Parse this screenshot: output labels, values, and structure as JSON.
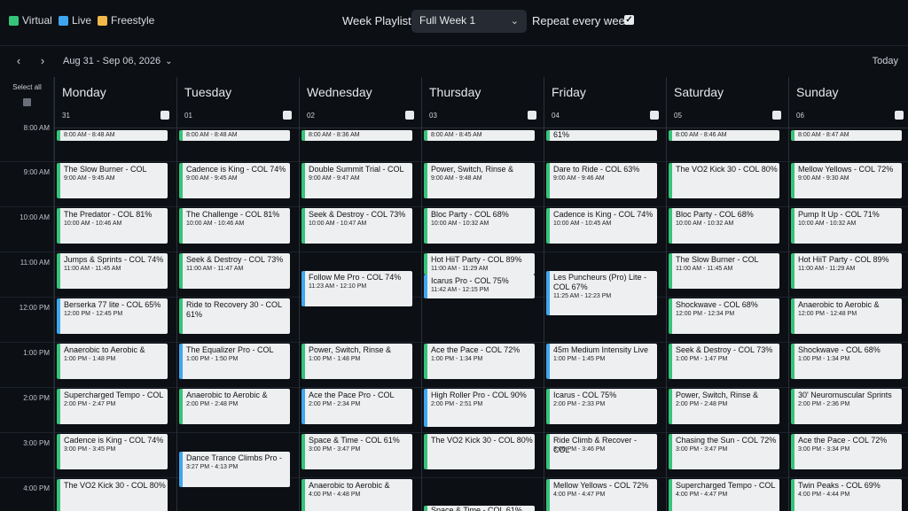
{
  "legend": [
    {
      "label": "Virtual",
      "color": "#36c47a"
    },
    {
      "label": "Live",
      "color": "#3fa7ee"
    },
    {
      "label": "Freestyle",
      "color": "#f2b94a"
    }
  ],
  "toolbar": {
    "week_playlist_label": "Week Playlist:",
    "week_playlist_value": "Full Week 1",
    "repeat_label": "Repeat every week",
    "repeat_checked": true
  },
  "nav": {
    "prev": "‹",
    "next": "›",
    "range": "Aug 31 - Sep 06, 2026",
    "today": "Today"
  },
  "grid": {
    "select_all": "Select all",
    "time_labels": [
      "8:00 AM",
      "9:00 AM",
      "10:00 AM",
      "11:00 AM",
      "12:00 PM",
      "1:00 PM",
      "2:00 PM",
      "3:00 PM",
      "4:00 PM"
    ],
    "days": [
      {
        "name": "Monday",
        "num": "31",
        "events": [
          {
            "title": "",
            "time": "8:00 AM - 8:48 AM",
            "type": "virtual",
            "slot": "8",
            "p": "cut"
          },
          {
            "title": "The Slow Burner - COL",
            "time": "9:00 AM - 9:45 AM",
            "type": "virtual",
            "slot": "9",
            "p": "n"
          },
          {
            "title": "The Predator - COL 81%",
            "time": "10:00 AM - 10:46 AM",
            "type": "virtual",
            "slot": "10",
            "p": "n"
          },
          {
            "title": "Jumps & Sprints - COL 74%",
            "time": "11:00 AM - 11:45 AM",
            "type": "virtual",
            "slot": "11",
            "p": "n"
          },
          {
            "title": "Berserka 77 lite - COL 65%",
            "time": "12:00 PM - 12:45 PM",
            "type": "live",
            "slot": "12",
            "p": "n"
          },
          {
            "title": "Anaerobic to Aerobic &",
            "time": "1:00 PM - 1:48 PM",
            "type": "virtual",
            "slot": "13",
            "p": "n"
          },
          {
            "title": "Supercharged Tempo - COL",
            "time": "2:00 PM - 2:47 PM",
            "type": "virtual",
            "slot": "14",
            "p": "n"
          },
          {
            "title": "Cadence is King - COL 74%",
            "time": "3:00 PM - 3:45 PM",
            "type": "virtual",
            "slot": "15",
            "p": "n"
          },
          {
            "title": "The VO2 Kick 30 - COL 80%",
            "time": "",
            "type": "virtual",
            "slot": "16",
            "p": "n"
          }
        ]
      },
      {
        "name": "Tuesday",
        "num": "01",
        "events": [
          {
            "title": "",
            "time": "8:00 AM - 8:48 AM",
            "type": "virtual",
            "slot": "8",
            "p": "cut"
          },
          {
            "title": "Cadence is King - COL 74%",
            "time": "9:00 AM - 9:45 AM",
            "type": "virtual",
            "slot": "9",
            "p": "n"
          },
          {
            "title": "The Challenge - COL 81%",
            "time": "10:00 AM - 10:46 AM",
            "type": "virtual",
            "slot": "10",
            "p": "n"
          },
          {
            "title": "Seek & Destroy - COL 73%",
            "time": "11:00 AM - 11:47 AM",
            "type": "virtual",
            "slot": "11",
            "p": "n"
          },
          {
            "title": "Ride to Recovery 30 - COL 61%",
            "time": "",
            "type": "virtual",
            "slot": "12",
            "p": "n"
          },
          {
            "title": "The Equalizer Pro - COL",
            "time": "1:00 PM - 1:50 PM",
            "type": "live",
            "slot": "13",
            "p": "n"
          },
          {
            "title": "Anaerobic to Aerobic &",
            "time": "2:00 PM - 2:48 PM",
            "type": "virtual",
            "slot": "14",
            "p": "n"
          },
          {
            "title": "Dance Trance Climbs Pro -",
            "time": "3:27 PM - 4:13 PM",
            "type": "live",
            "slot": "15",
            "p": "off"
          }
        ]
      },
      {
        "name": "Wednesday",
        "num": "02",
        "events": [
          {
            "title": "",
            "time": "8:00 AM - 8:36 AM",
            "type": "virtual",
            "slot": "8",
            "p": "cut"
          },
          {
            "title": "Double Summit Trial - COL",
            "time": "9:00 AM - 9:47 AM",
            "type": "virtual",
            "slot": "9",
            "p": "n"
          },
          {
            "title": "Seek & Destroy - COL 73%",
            "time": "10:00 AM - 10:47 AM",
            "type": "virtual",
            "slot": "10",
            "p": "n"
          },
          {
            "title": "Follow Me Pro - COL 74%",
            "time": "11:23 AM - 12:10 PM",
            "type": "live",
            "slot": "11",
            "p": "off"
          },
          {
            "title": "Power, Switch, Rinse &",
            "time": "1:00 PM - 1:48 PM",
            "type": "virtual",
            "slot": "13",
            "p": "n"
          },
          {
            "title": "Ace the Pace Pro - COL",
            "time": "2:00 PM - 2:34 PM",
            "type": "live",
            "slot": "14",
            "p": "n"
          },
          {
            "title": "Space & Time - COL 61%",
            "time": "3:00 PM - 3:47 PM",
            "type": "virtual",
            "slot": "15",
            "p": "n"
          },
          {
            "title": "Anaerobic to Aerobic &",
            "time": "4:00 PM - 4:48 PM",
            "type": "virtual",
            "slot": "16",
            "p": "n"
          }
        ]
      },
      {
        "name": "Thursday",
        "num": "03",
        "events": [
          {
            "title": "",
            "time": "8:00 AM - 8:45 AM",
            "type": "virtual",
            "slot": "8",
            "p": "cut"
          },
          {
            "title": "Power, Switch, Rinse &",
            "time": "9:00 AM - 9:48 AM",
            "type": "virtual",
            "slot": "9",
            "p": "n"
          },
          {
            "title": "Bloc Party - COL 68%",
            "time": "10:00 AM - 10:32 AM",
            "type": "virtual",
            "slot": "10",
            "p": "n"
          },
          {
            "title": "Hot HiiT Party - COL 89%",
            "time": "11:00 AM - 11:29 AM",
            "type": "virtual",
            "slot": "11",
            "p": "half"
          },
          {
            "title": "Icarus Pro - COL 75%",
            "time": "11:42 AM - 12:15 PM",
            "type": "live",
            "slot": "11",
            "p": "off2"
          },
          {
            "title": "Ace the Pace - COL 72%",
            "time": "1:00 PM - 1:34 PM",
            "type": "virtual",
            "slot": "13",
            "p": "n"
          },
          {
            "title": "High Roller Pro - COL 90%",
            "time": "2:00 PM - 2:51 PM",
            "type": "live",
            "slot": "14",
            "p": "tall"
          },
          {
            "title": "The VO2 Kick 30 - COL 80%",
            "time": "",
            "type": "virtual",
            "slot": "15",
            "p": "n"
          },
          {
            "title": "Space & Time - COL 61%",
            "time": "",
            "type": "virtual",
            "slot": "16",
            "p": "bottom"
          }
        ]
      },
      {
        "name": "Friday",
        "num": "04",
        "events": [
          {
            "title": "61%",
            "time": "",
            "type": "virtual",
            "slot": "8",
            "p": "cut1"
          },
          {
            "title": "Dare to Ride - COL 63%",
            "time": "9:00 AM - 9:46 AM",
            "type": "virtual",
            "slot": "9",
            "p": "n"
          },
          {
            "title": "Cadence is King - COL 74%",
            "time": "10:00 AM - 10:45 AM",
            "type": "virtual",
            "slot": "10",
            "p": "n"
          },
          {
            "title": "Les Puncheurs (Pro) Lite - COL 67%",
            "time": "11:25 AM - 12:23 PM",
            "type": "live",
            "slot": "11",
            "p": "lp"
          },
          {
            "title": "45m Medium Intensity Live",
            "time": "1:00 PM - 1:45 PM",
            "type": "live",
            "slot": "13",
            "p": "n"
          },
          {
            "title": "Icarus - COL 75%",
            "time": "2:00 PM - 2:33 PM",
            "type": "virtual",
            "slot": "14",
            "p": "n"
          },
          {
            "title": "Ride Climb & Recover - COL",
            "time": "3:00 PM - 3:46 PM",
            "type": "virtual",
            "slot": "15",
            "p": "n"
          },
          {
            "title": "Mellow Yellows - COL 72%",
            "time": "4:00 PM - 4:47 PM",
            "type": "virtual",
            "slot": "16",
            "p": "n"
          }
        ]
      },
      {
        "name": "Saturday",
        "num": "05",
        "events": [
          {
            "title": "",
            "time": "8:00 AM - 8:46 AM",
            "type": "virtual",
            "slot": "8",
            "p": "cut"
          },
          {
            "title": "The VO2 Kick 30 - COL 80%",
            "time": "",
            "type": "virtual",
            "slot": "9",
            "p": "n"
          },
          {
            "title": "Bloc Party - COL 68%",
            "time": "10:00 AM - 10:32 AM",
            "type": "virtual",
            "slot": "10",
            "p": "n"
          },
          {
            "title": "The Slow Burner - COL",
            "time": "11:00 AM - 11:45 AM",
            "type": "virtual",
            "slot": "11",
            "p": "n"
          },
          {
            "title": "Shockwave - COL 68%",
            "time": "12:00 PM - 12:34 PM",
            "type": "virtual",
            "slot": "12",
            "p": "n"
          },
          {
            "title": "Seek & Destroy - COL 73%",
            "time": "1:00 PM - 1:47 PM",
            "type": "virtual",
            "slot": "13",
            "p": "n"
          },
          {
            "title": "Power, Switch, Rinse &",
            "time": "2:00 PM - 2:48 PM",
            "type": "virtual",
            "slot": "14",
            "p": "n"
          },
          {
            "title": "Chasing the Sun - COL 72%",
            "time": "3:00 PM - 3:47 PM",
            "type": "virtual",
            "slot": "15",
            "p": "n"
          },
          {
            "title": "Supercharged Tempo - COL",
            "time": "4:00 PM - 4:47 PM",
            "type": "virtual",
            "slot": "16",
            "p": "n"
          }
        ]
      },
      {
        "name": "Sunday",
        "num": "06",
        "events": [
          {
            "title": "",
            "time": "8:00 AM - 8:47 AM",
            "type": "virtual",
            "slot": "8",
            "p": "cut"
          },
          {
            "title": "Mellow Yellows - COL 72%",
            "time": "9:00 AM - 9:30 AM",
            "type": "virtual",
            "slot": "9",
            "p": "n"
          },
          {
            "title": "Pump It Up - COL 71%",
            "time": "10:00 AM - 10:32 AM",
            "type": "virtual",
            "slot": "10",
            "p": "n"
          },
          {
            "title": "Hot HiiT Party - COL 89%",
            "time": "11:00 AM - 11:29 AM",
            "type": "virtual",
            "slot": "11",
            "p": "n"
          },
          {
            "title": "Anaerobic to Aerobic &",
            "time": "12:00 PM - 12:48 PM",
            "type": "virtual",
            "slot": "12",
            "p": "n"
          },
          {
            "title": "Shockwave - COL 68%",
            "time": "1:00 PM - 1:34 PM",
            "type": "virtual",
            "slot": "13",
            "p": "n"
          },
          {
            "title": "30' Neuromuscular Sprints",
            "time": "2:00 PM - 2:36 PM",
            "type": "virtual",
            "slot": "14",
            "p": "n"
          },
          {
            "title": "Ace the Pace - COL 72%",
            "time": "3:00 PM - 3:34 PM",
            "type": "virtual",
            "slot": "15",
            "p": "n"
          },
          {
            "title": "Twin Peaks - COL 69%",
            "time": "4:00 PM - 4:44 PM",
            "type": "virtual",
            "slot": "16",
            "p": "n"
          }
        ]
      }
    ]
  }
}
